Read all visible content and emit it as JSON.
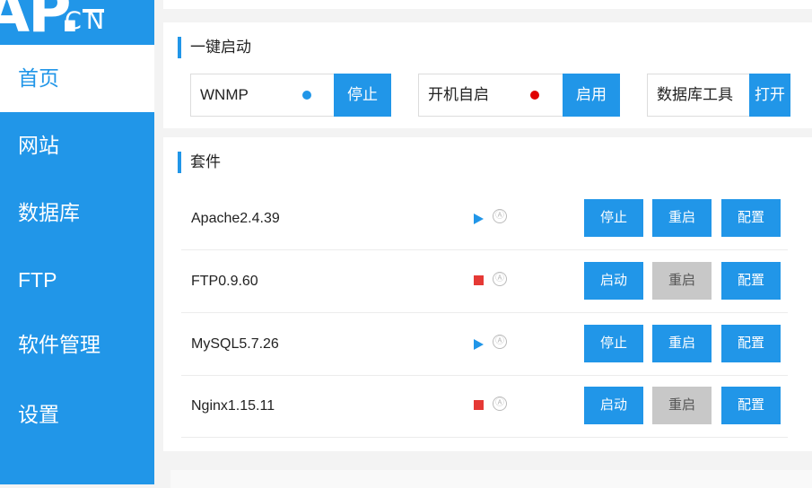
{
  "brand": {
    "logo_big": "AP.",
    "logo_cn": "CN"
  },
  "sidebar": {
    "items": [
      {
        "label": "首页",
        "name": "sidebar-item-home",
        "active": true
      },
      {
        "label": "网站",
        "name": "sidebar-item-website"
      },
      {
        "label": "数据库",
        "name": "sidebar-item-database"
      },
      {
        "label": "FTP",
        "name": "sidebar-item-ftp"
      },
      {
        "label": "软件管理",
        "name": "sidebar-item-software"
      },
      {
        "label": "设置",
        "name": "sidebar-item-settings"
      }
    ]
  },
  "quick_start": {
    "title": "一键启动",
    "items": [
      {
        "label": "WNMP",
        "status": "running",
        "status_color": "#2196e8",
        "button": "停止"
      },
      {
        "label": "开机自启",
        "status": "off",
        "status_color": "#e00000",
        "button": "启用"
      },
      {
        "label": "数据库工具",
        "button": "打开"
      }
    ]
  },
  "suite": {
    "title": "套件",
    "rows": [
      {
        "name": "Apache2.4.39",
        "state": "running",
        "auto": "Ⓐ",
        "primary": "停止",
        "restart": "重启",
        "restart_enabled": true,
        "config": "配置"
      },
      {
        "name": "FTP0.9.60",
        "state": "stopped",
        "auto": "Ⓐ",
        "primary": "启动",
        "restart": "重启",
        "restart_enabled": false,
        "config": "配置"
      },
      {
        "name": "MySQL5.7.26",
        "state": "running",
        "auto": "Ⓐ",
        "primary": "停止",
        "restart": "重启",
        "restart_enabled": true,
        "config": "配置"
      },
      {
        "name": "Nginx1.15.11",
        "state": "stopped",
        "auto": "Ⓐ",
        "primary": "启动",
        "restart": "重启",
        "restart_enabled": false,
        "config": "配置"
      }
    ]
  },
  "colors": {
    "accent": "#2196e8",
    "running": "#2196e8",
    "stopped": "#e53935",
    "disabled": "#c8c8c8"
  }
}
